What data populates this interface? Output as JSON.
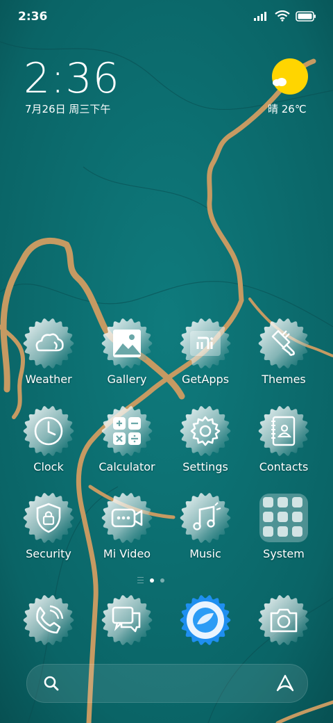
{
  "status": {
    "time": "2:36"
  },
  "clock": {
    "time": "2:36",
    "date": "7月26日 周三下午"
  },
  "weather": {
    "text": "晴 26℃"
  },
  "apps": [
    {
      "label": "Weather",
      "icon": "weather-icon"
    },
    {
      "label": "Gallery",
      "icon": "gallery-icon"
    },
    {
      "label": "GetApps",
      "icon": "getapps-icon"
    },
    {
      "label": "Themes",
      "icon": "themes-icon"
    },
    {
      "label": "Clock",
      "icon": "clock-icon"
    },
    {
      "label": "Calculator",
      "icon": "calculator-icon"
    },
    {
      "label": "Settings",
      "icon": "settings-gear-icon"
    },
    {
      "label": "Contacts",
      "icon": "contacts-icon"
    },
    {
      "label": "Security",
      "icon": "security-shield-icon"
    },
    {
      "label": "Mi Video",
      "icon": "video-icon"
    },
    {
      "label": "Music",
      "icon": "music-icon"
    },
    {
      "label": "System",
      "icon": "system-folder-icon"
    }
  ],
  "dock": [
    {
      "icon": "phone-icon"
    },
    {
      "icon": "messages-icon"
    },
    {
      "icon": "browser-icon"
    },
    {
      "icon": "camera-icon"
    }
  ],
  "pager": {
    "pages": 2,
    "current": 1
  },
  "colors": {
    "teal": "#0b6c6f",
    "gold": "#c9a06a",
    "sun": "#ffd500"
  }
}
